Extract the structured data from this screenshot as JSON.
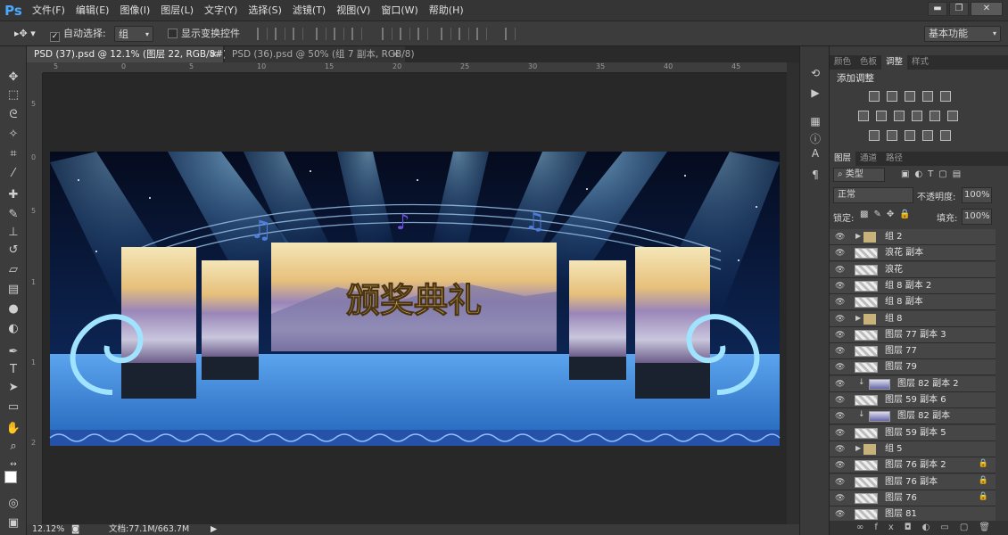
{
  "app": {
    "logo": "Ps"
  },
  "menu": [
    "文件(F)",
    "编辑(E)",
    "图像(I)",
    "图层(L)",
    "文字(Y)",
    "选择(S)",
    "滤镜(T)",
    "视图(V)",
    "窗口(W)",
    "帮助(H)"
  ],
  "window_controls": {
    "minimize": "▬",
    "restore": "❐",
    "close": "✕"
  },
  "options": {
    "auto_select_label": "自动选择:",
    "auto_select_value": "组",
    "show_transform_label": "显示变换控件",
    "workspace": "基本功能"
  },
  "tabs": [
    {
      "label": "PSD (37).psd @ 12.1% (图层 22, RGB/8#) *",
      "close": "×"
    },
    {
      "label": "PSD (36).psd @ 50% (组 7 副本, RGB/8)",
      "close": "×"
    }
  ],
  "ruler": {
    "h_ticks": [
      "5",
      "0",
      "5",
      "10",
      "15",
      "20",
      "25",
      "30",
      "35",
      "40",
      "45"
    ],
    "v_ticks": [
      "5",
      "0",
      "5",
      "1",
      "1",
      "2"
    ]
  },
  "canvas": {
    "title_text": "颁奖典礼",
    "sky_color": "#0b1a3a",
    "floor_color": "#2b6fc2"
  },
  "status": {
    "zoom": "12.12%",
    "doc": "文档:77.1M/663.7M"
  },
  "adjust_panel": {
    "tabs": [
      "颜色",
      "色板",
      "调整",
      "样式"
    ],
    "active": "调整",
    "title": "添加调整"
  },
  "layers_panel": {
    "tabs": [
      "图层",
      "通道",
      "路径"
    ],
    "active": "图层",
    "filter": "类型",
    "blend": "正常",
    "opacity_label": "不透明度:",
    "opacity_value": "100%",
    "lock_label": "锁定:",
    "fill_label": "填充:",
    "fill_value": "100%",
    "layers": [
      {
        "name": "组 2",
        "kind": "folder"
      },
      {
        "name": "浪花 副本",
        "kind": "layer"
      },
      {
        "name": "浪花",
        "kind": "layer"
      },
      {
        "name": "组 8 副本 2",
        "kind": "layer"
      },
      {
        "name": "组 8 副本",
        "kind": "layer"
      },
      {
        "name": "组 8",
        "kind": "folder"
      },
      {
        "name": "图层 77 副本 3",
        "kind": "layer"
      },
      {
        "name": "图层 77",
        "kind": "layer"
      },
      {
        "name": "图层 79",
        "kind": "layer"
      },
      {
        "name": "图层 82 副本 2",
        "kind": "clip"
      },
      {
        "name": "图层 59 副本 6",
        "kind": "layer"
      },
      {
        "name": "图层 82 副本",
        "kind": "clip"
      },
      {
        "name": "图层 59 副本 5",
        "kind": "layer"
      },
      {
        "name": "组 5",
        "kind": "folder"
      },
      {
        "name": "图层 76 副本 2",
        "kind": "layer",
        "locked": true
      },
      {
        "name": "图层 76 副本",
        "kind": "layer",
        "locked": true
      },
      {
        "name": "图层 76",
        "kind": "layer",
        "locked": true
      },
      {
        "name": "图层 81",
        "kind": "layer"
      }
    ]
  }
}
